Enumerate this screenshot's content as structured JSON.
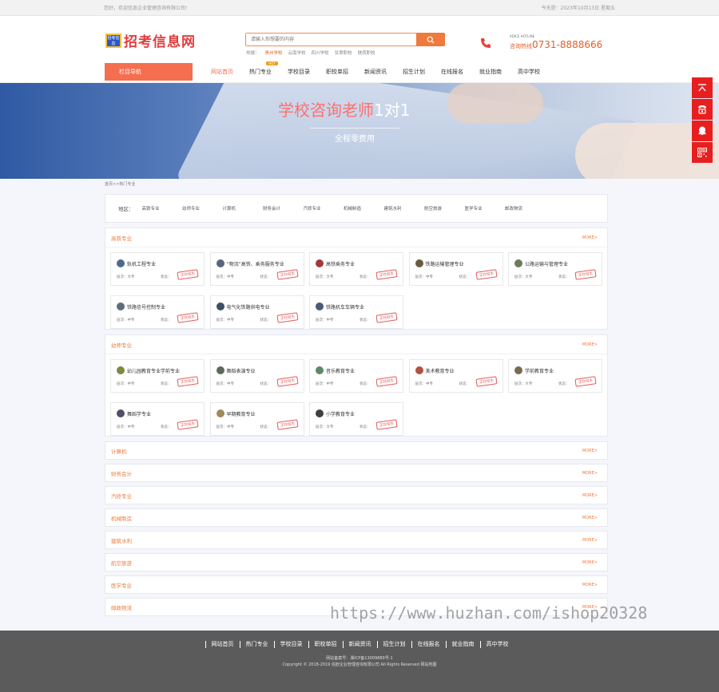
{
  "topbar": {
    "welcome": "您好，欢迎信息企业管理咨询有限公司!",
    "date": "今天是：2023年10月13日 星期五"
  },
  "header": {
    "logo_badge": "招考信息",
    "logo_text": "招考信息网",
    "search_placeholder": "请输入你想要的内容",
    "hotwords_label": "热搜：",
    "hotwords": [
      "贵州学校",
      "云南学校",
      "四川学校",
      "甘肃职校",
      "陕西职校"
    ],
    "phone_small": "ADICE HOTLINE",
    "phone_label": "咨询热线",
    "phone_number": "0731-8888666"
  },
  "nav": {
    "button": "栏目导航",
    "items": [
      {
        "label": "网站首页",
        "active": true
      },
      {
        "label": "热门专业",
        "tag": "HOT"
      },
      {
        "label": "学校目录"
      },
      {
        "label": "职校单招"
      },
      {
        "label": "新闻资讯"
      },
      {
        "label": "招生计划"
      },
      {
        "label": "在线报名"
      },
      {
        "label": "就业指南"
      },
      {
        "label": "高中学校"
      }
    ]
  },
  "banner": {
    "title_red": "学校咨询老师",
    "title_white": "1对1",
    "subtitle": "全程零费用"
  },
  "breadcrumb": "首页>>热门专业",
  "region": {
    "label": "地区：",
    "items": [
      "高铁专业",
      "幼师专业",
      "计算机",
      "财务会计",
      "汽修专业",
      "机械制造",
      "建筑水利",
      "航空旅游",
      "医学专业",
      "邮政物流"
    ]
  },
  "sections": [
    {
      "title": "高铁专业",
      "more": "MORE>",
      "cards": [
        {
          "name": "轨机工程专业",
          "level": "层次：大专",
          "status": "状态：",
          "stamp": "正在招生",
          "color": "#4d6a8c"
        },
        {
          "name": "“物流”高铁、乘务服务专业",
          "level": "层次：中专",
          "status": "状态：",
          "stamp": "正在招生",
          "color": "#556680"
        },
        {
          "name": "高铁乘务专业",
          "level": "层次：大专",
          "status": "状态：",
          "stamp": "正在招生",
          "color": "#a33a3a"
        },
        {
          "name": "铁路运输管理专业",
          "level": "层次：中专",
          "status": "状态：",
          "stamp": "正在招生",
          "color": "#6b5a3f"
        },
        {
          "name": "公路运输与管理专业",
          "level": "层次：大专",
          "status": "状态：",
          "stamp": "正在招生",
          "color": "#6a7c5a"
        },
        {
          "name": "铁路信号控制专业",
          "level": "层次：中专",
          "status": "状态：",
          "stamp": "正在招生",
          "color": "#5c6e7a"
        },
        {
          "name": "电气化铁路供电专业",
          "level": "层次：中专",
          "status": "状态：",
          "stamp": "正在招生",
          "color": "#3f4f66"
        },
        {
          "name": "铁路机车车辆专业",
          "level": "层次：中专",
          "status": "状态：",
          "stamp": "正在招生",
          "color": "#4a5a78"
        }
      ]
    },
    {
      "title": "幼师专业",
      "more": "MORE>",
      "cards": [
        {
          "name": "幼儿园教育专业学前专业",
          "level": "层次：中专",
          "status": "状态：",
          "stamp": "正在招生",
          "color": "#7a8a3f"
        },
        {
          "name": "舞蹈表演专业",
          "level": "层次：中专",
          "status": "状态：",
          "stamp": "正在招生",
          "color": "#5d6a5a"
        },
        {
          "name": "音乐教育专业",
          "level": "层次：中专",
          "status": "状态：",
          "stamp": "正在招生",
          "color": "#5a8a6a"
        },
        {
          "name": "美术教育专业",
          "level": "层次：中专",
          "status": "状态：",
          "stamp": "正在招生",
          "color": "#b0533f"
        },
        {
          "name": "学前教育专业",
          "level": "层次：大专",
          "status": "状态：",
          "stamp": "正在招生",
          "color": "#7a6a4f"
        },
        {
          "name": "舞蹈学专业",
          "level": "层次：中专",
          "status": "状态：",
          "stamp": "正在招生",
          "color": "#4f4f6a"
        },
        {
          "name": "早期教育专业",
          "level": "层次：中专",
          "status": "状态：",
          "stamp": "正在招生",
          "color": "#a08a5a"
        },
        {
          "name": "小学教育专业",
          "level": "层次：大专",
          "status": "状态：",
          "stamp": "正在招生",
          "color": "#3f3f3f"
        }
      ]
    }
  ],
  "collapsed_sections": [
    {
      "title": "计算机",
      "more": "MORE>"
    },
    {
      "title": "财务会计",
      "more": "MORE>"
    },
    {
      "title": "汽修专业",
      "more": "MORE>"
    },
    {
      "title": "机械制造",
      "more": "MORE>"
    },
    {
      "title": "建筑水利",
      "more": "MORE>"
    },
    {
      "title": "航空旅游",
      "more": "MORE>"
    },
    {
      "title": "医学专业",
      "more": "MORE>"
    },
    {
      "title": "邮政物流",
      "more": "MORE>"
    }
  ],
  "sidebar": [
    "top-icon",
    "phone-icon",
    "qq-icon",
    "qrcode-icon"
  ],
  "footer": {
    "links": [
      "网站首页",
      "热门专业",
      "学校目录",
      "职校单招",
      "新闻资讯",
      "招生计划",
      "在线报名",
      "就业指南",
      "高中学校"
    ],
    "beian": "网站备案号：湘ICP备13009889号-1",
    "copyright": "Copyright © 2018-2019 信欧企业管理咨询有限公司 All Rights Reserved 网站地图"
  },
  "watermark": "https://www.huzhan.com/ishop20328",
  "colors": {
    "accent": "#f46e4f",
    "orange": "#f07a3d",
    "sidebar_red": "#e81f1f",
    "footer_bg": "#5b5b5b"
  }
}
